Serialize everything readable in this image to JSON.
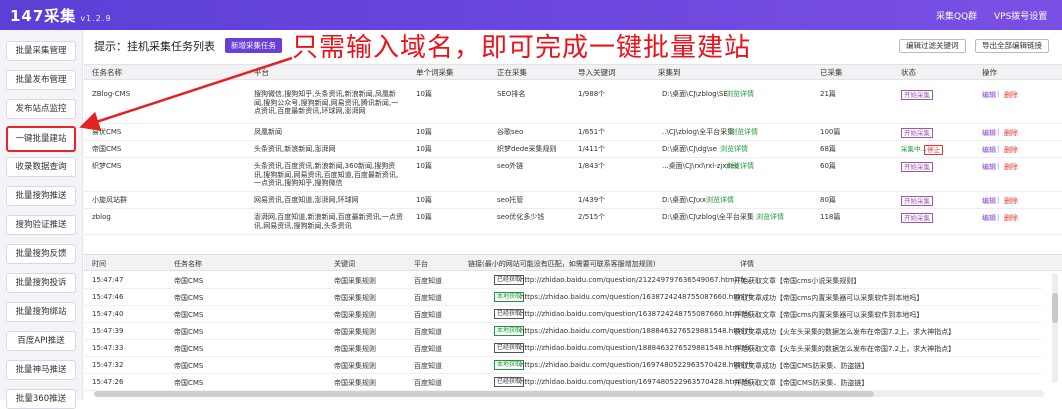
{
  "app": {
    "title": "147采集",
    "version": "v1.2.9",
    "links": [
      "采集QQ群",
      "VPS拨号设置"
    ]
  },
  "sidebar": {
    "items": [
      {
        "label": "批量采集管理"
      },
      {
        "label": "批量发布管理"
      },
      {
        "label": "发布站点监控"
      },
      {
        "label": "一键批量建站"
      },
      {
        "label": "收录数据查询"
      },
      {
        "label": "批量搜狗推送"
      },
      {
        "label": "搜狗验证推送"
      },
      {
        "label": "批量搜狗反馈"
      },
      {
        "label": "批量搜狗投诉"
      },
      {
        "label": "批量搜狗绑站"
      },
      {
        "label": "百度API推送"
      },
      {
        "label": "批量神马推送"
      },
      {
        "label": "批量360推送"
      }
    ]
  },
  "main": {
    "hint": "提示：挂机采集任务列表",
    "new_task_btn": "新增采集任务",
    "banner": "只需输入域名，即可完成一键批量建站",
    "btn_edit_filter": "编辑过滤关键词",
    "btn_export": "导出全部编辑链接"
  },
  "task_table": {
    "headers": [
      "任务名称",
      "平台",
      "单个词采集",
      "正在采集",
      "导入关键词",
      "采集到",
      "已采集",
      "状态",
      "操作"
    ],
    "rows": [
      {
        "name": "ZBlog-CMS",
        "platform": "搜狗微信,搜狗知乎,头条资讯,新浪新闻,凤凰新闻,搜狗公众号,搜狗新闻,网易资讯,腾讯新闻,一点资讯,百度最新资讯,环球网,澎湃网",
        "per_word": "10篇",
        "collecting": "SEO排名",
        "keywords": "1/988个",
        "dest": "D:\\桌面\\CJ\\zblog\\SE",
        "dest_link": "浏览详情",
        "collected": "21篇",
        "status": "开始采集",
        "edit": "编辑",
        "delete": "删除"
      },
      {
        "name": "易优CMS",
        "platform": "凤凰新闻",
        "per_word": "10篇",
        "collecting": "谷歌seo",
        "keywords": "1/651个",
        "dest": "..\\CJ\\zblog\\全平台采集",
        "dest_link": "浏览详情",
        "collected": "100篇",
        "status": "开始采集",
        "edit": "编辑",
        "delete": "删除"
      },
      {
        "name": "帝国CMS",
        "platform": "头条资讯,新浪新闻,澎湃网",
        "per_word": "10篇",
        "collecting": "织梦dede采集规则",
        "keywords": "1/411个",
        "dest": "D:\\桌面\\CJ\\dg\\se",
        "dest_link": "浏览详情",
        "collected": "68篇",
        "status": "采集中...",
        "status2": "停止",
        "edit": "编辑",
        "delete": "删除"
      },
      {
        "name": "织梦CMS",
        "platform": "头条资讯,百度资讯,新浪新闻,360新闻,搜狗资讯,搜狗新闻,网易资讯,百度知道,百度最新资讯,一点资讯,搜狗知乎,搜狗微信",
        "per_word": "10篇",
        "collecting": "seo外链",
        "keywords": "1/843个",
        "dest": "...桌面\\CJ\\rxl\\rxl-zjxseo",
        "dest_link": "浏览详情",
        "collected": "60篇",
        "status": "开始采集",
        "edit": "编辑",
        "delete": "删除"
      },
      {
        "name": "小旋风站群",
        "platform": "网易资讯,百度知道,澎湃网,环球网",
        "per_word": "10篇",
        "collecting": "seo托管",
        "keywords": "1/439个",
        "dest": "D:\\桌面\\CJ\\xx",
        "dest_link": "浏览详情",
        "collected": "80篇",
        "status": "开始采集",
        "edit": "编辑",
        "delete": "删除"
      },
      {
        "name": "zblog",
        "platform": "澎湃网,百度知道,新浪新闻,百度最新资讯,一点资讯,网易资讯,搜狗新闻,头条资讯",
        "per_word": "10篇",
        "collecting": "seo优化多少钱",
        "keywords": "2/515个",
        "dest": "D:\\桌面\\CJ\\zblog\\全平台采集",
        "dest_link": "浏览详情",
        "collected": "118篇",
        "status": "开始采集",
        "edit": "编辑",
        "delete": "删除"
      }
    ]
  },
  "log_table": {
    "headers": [
      "时间",
      "任务名称",
      "关键词",
      "平台",
      "链接(最小的网站可能没有匹配，如需要可联系客服增加规则)",
      "详情"
    ],
    "rows": [
      {
        "time": "15:47:47",
        "task": "帝国CMS",
        "keyword": "帝国采集规则",
        "platform": "百度知道",
        "tag": "已经获取",
        "tag_ok": false,
        "url": "http://zhidao.baidu.com/question/212249797636549067.html?fr...",
        "detail": "开始获取文章【帝国cms小说采集规则】"
      },
      {
        "time": "15:47:46",
        "task": "帝国CMS",
        "keyword": "帝国采集规则",
        "platform": "百度知道",
        "tag": "本地获取",
        "tag_ok": true,
        "url": "https://zhidao.baidu.com/question/1638724248755087660.html?fr...",
        "detail": "获取文章成功【帝国cms内置采集器可以采集软件到本地吗】"
      },
      {
        "time": "15:47:40",
        "task": "帝国CMS",
        "keyword": "帝国采集规则",
        "platform": "百度知道",
        "tag": "已经获取",
        "tag_ok": false,
        "url": "http://zhidao.baidu.com/question/1638724248755087660.html?fr...",
        "detail": "开始获取文章【帝国cms内置采集器可以采集软件到本地吗】"
      },
      {
        "time": "15:47:39",
        "task": "帝国CMS",
        "keyword": "帝国采集规则",
        "platform": "百度知道",
        "tag": "本地获取",
        "tag_ok": true,
        "url": "https://zhidao.baidu.com/question/1888463276529881548.html?fr...",
        "detail": "获取文章成功【火车头采集的数据怎么发布在帝国7.2上，求大神指点】"
      },
      {
        "time": "15:47:33",
        "task": "帝国CMS",
        "keyword": "帝国采集规则",
        "platform": "百度知道",
        "tag": "已经获取",
        "tag_ok": false,
        "url": "http://zhidao.baidu.com/question/1888463276529881548.html?fr...",
        "detail": "开始获取文章【火车头采集的数据怎么发布在帝国7.2上，求大神指点】"
      },
      {
        "time": "15:47:32",
        "task": "帝国CMS",
        "keyword": "帝国采集规则",
        "platform": "百度知道",
        "tag": "本地获取",
        "tag_ok": true,
        "url": "https://zhidao.baidu.com/question/1697480522963570428.html?fr...",
        "detail": "获取文章成功【帝国CMS防采集、防盗链】"
      },
      {
        "time": "15:47:26",
        "task": "帝国CMS",
        "keyword": "帝国采集规则",
        "platform": "百度知道",
        "tag": "已经获取",
        "tag_ok": false,
        "url": "http://zhidao.baidu.com/question/1697480522963570428.html?fr...",
        "detail": "开始获取文章【帝国CMS防采集、防盗链】"
      }
    ]
  },
  "colors": {
    "accent": "#6a3fd8",
    "banner": "#e8141c",
    "highlight": "#e22222",
    "link_green": "#1c9a3a"
  }
}
